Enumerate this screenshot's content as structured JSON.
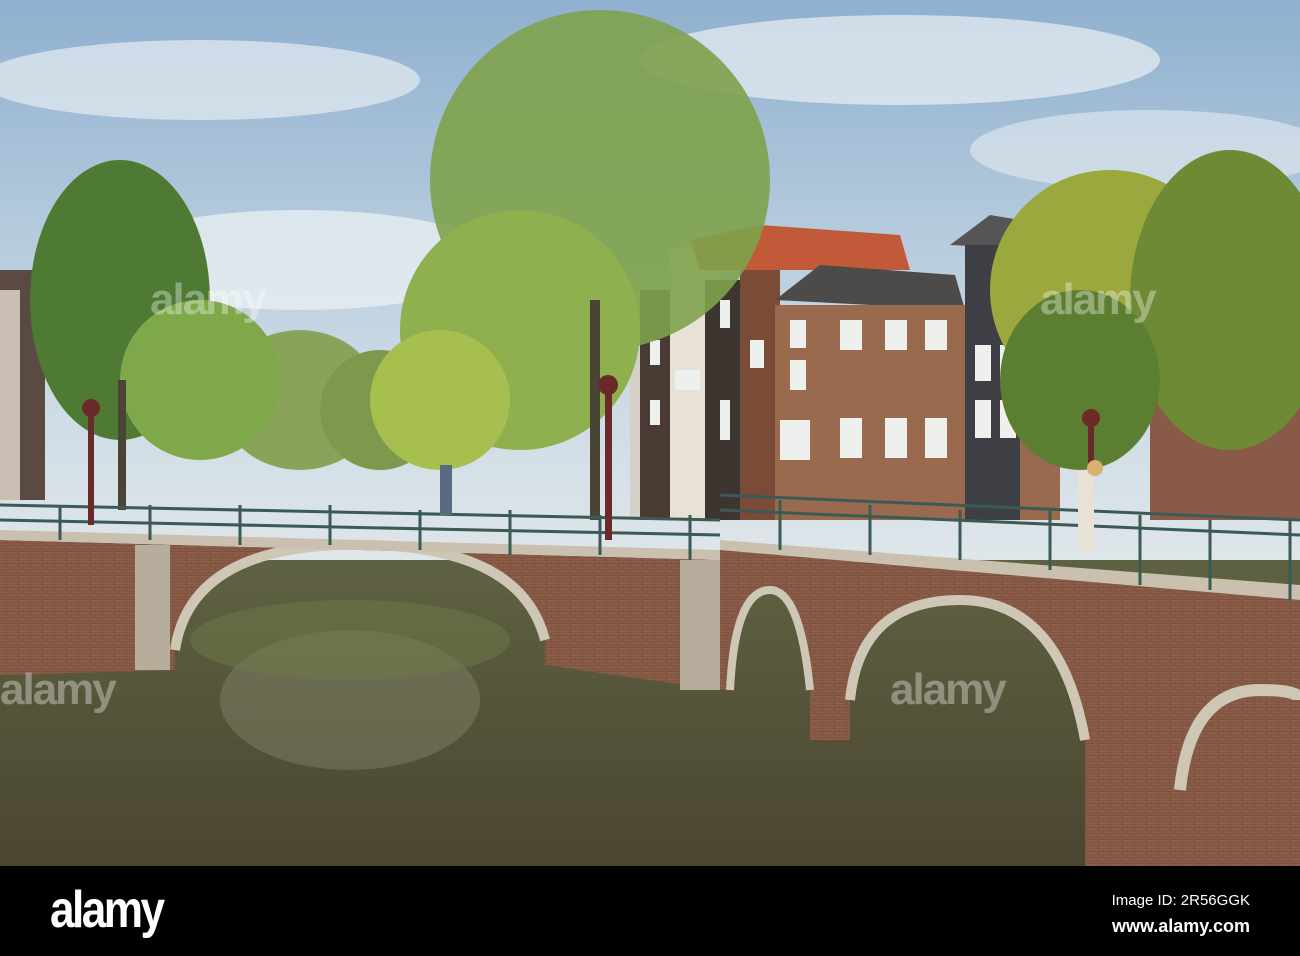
{
  "photo": {
    "subject": "Amsterdam canal with brick arch bridges",
    "colors": {
      "sky": "#b9cfe0",
      "water": "#58583a",
      "brick": "#8a5a45",
      "tree": "#6f9a3c",
      "rail": "#3c5a55"
    }
  },
  "watermark": {
    "text": "alamy"
  },
  "footer": {
    "logo": "alamy",
    "image_id": "Image ID: 2R56GGK",
    "website": "www.alamy.com"
  }
}
